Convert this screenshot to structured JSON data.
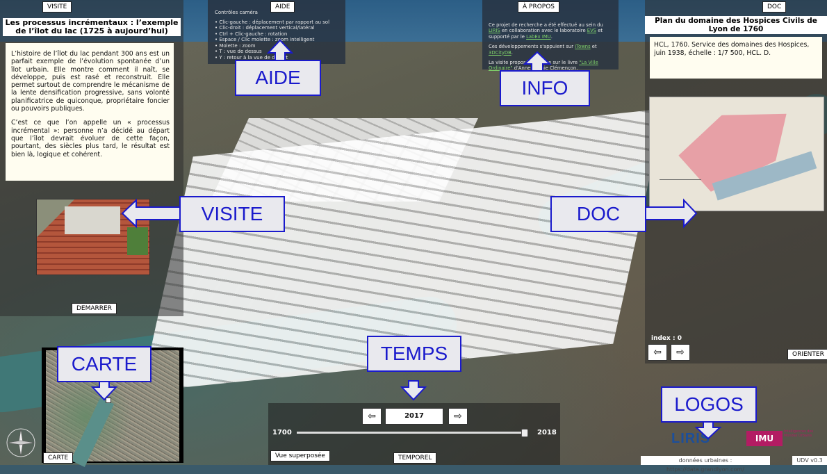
{
  "tabs": {
    "visite": "VISITE",
    "aide": "AIDE",
    "apropos": "À PROPOS",
    "doc": "DOC",
    "carte": "CARTE",
    "temporel": "TEMPOREL"
  },
  "visite": {
    "title": "Les processus incrémentaux : l’exemple de l’îlot du lac (1725 à aujourd’hui)",
    "paragraph1": "L’histoire de l’îlot du lac pendant 300 ans est un parfait exemple de l’évolution spontanée d’un îlot urbain. Elle montre comment il naît, se développe, puis est rasé et reconstruit. Elle permet surtout de comprendre le mécanisme de la lente densification progressive, sans volonté planificatrice de quiconque, propriétaire foncier ou pouvoirs publiques.",
    "paragraph2": "C’est ce que l’on appelle un « processus incrémental »: personne n’a décidé au départ que l’îlot devrait évoluer de cette façon, pourtant, des siècles plus tard, le résultat est bien là, logique et cohérent.",
    "start_button": "DEMARRER"
  },
  "aide": {
    "heading": "Contrôles caméra",
    "items": [
      "• Clic-gauche : déplacement par rapport au sol",
      "• Clic-droit : déplacement vertical/latéral",
      "• Ctrl + Clic-gauche : rotation",
      "• Espace / Clic molette : zoom intelligent",
      "• Molette : zoom",
      "• T : vue de dessus",
      "• Y : retour à la vue de départ"
    ]
  },
  "info": {
    "p1_a": "Ce projet de recherche a été effectué au sein du ",
    "p1_link1": "LIRIS",
    "p1_b": " en collaboration avec le laboratoire ",
    "p1_link2": "EVS",
    "p1_c": " et supporté par le ",
    "p1_link3": "LabEx IMU",
    "p1_d": ".",
    "p2_a": "Ces développements s'appuient sur ",
    "p2_link1": "iTowns",
    "p2_b": " et ",
    "p2_link2": "3DCityDB",
    "p2_c": ".",
    "p3_a": "La visite proposée se base sur le livre ",
    "p3_link": "\"La Ville Ordinaire\"",
    "p3_b": " d'Anne-Sophie Clémençon."
  },
  "doc": {
    "title": "Plan du domaine des Hospices Civils de Lyon de 1760",
    "description": "HCL, 1760. Service des domaines des Hospices, juin 1938, échelle : 1/7 500, HCL. D.",
    "index_label": "index : 0",
    "prev_arrow": "⇦",
    "next_arrow": "⇨",
    "orient_button": "ORIENTER"
  },
  "temps": {
    "prev_arrow": "⇦",
    "next_arrow": "⇨",
    "year": "2017",
    "min_year": "1700",
    "max_year": "2018",
    "slider_fraction": 0.9874,
    "overlay_button": "Vue superposée"
  },
  "overlays": {
    "aide": "AIDE",
    "info": "INFO",
    "visite": "VISITE",
    "doc": "DOC",
    "carte": "CARTE",
    "temps": "TEMPS",
    "logos": "LOGOS"
  },
  "logos": {
    "liris": "LIRIS",
    "imu": "IMU",
    "imu_sub": "Intelligences des Mondes Urbains"
  },
  "footer": {
    "credit": "données urbaines : https://data.grandlyon.com/",
    "version": "UDV v0.3"
  },
  "colors": {
    "overlay_border": "#1a1acc",
    "overlay_bg": "#e9e9ee",
    "link": "#7fd16a",
    "imu": "#b31c63",
    "liris": "#1d4f9a"
  }
}
